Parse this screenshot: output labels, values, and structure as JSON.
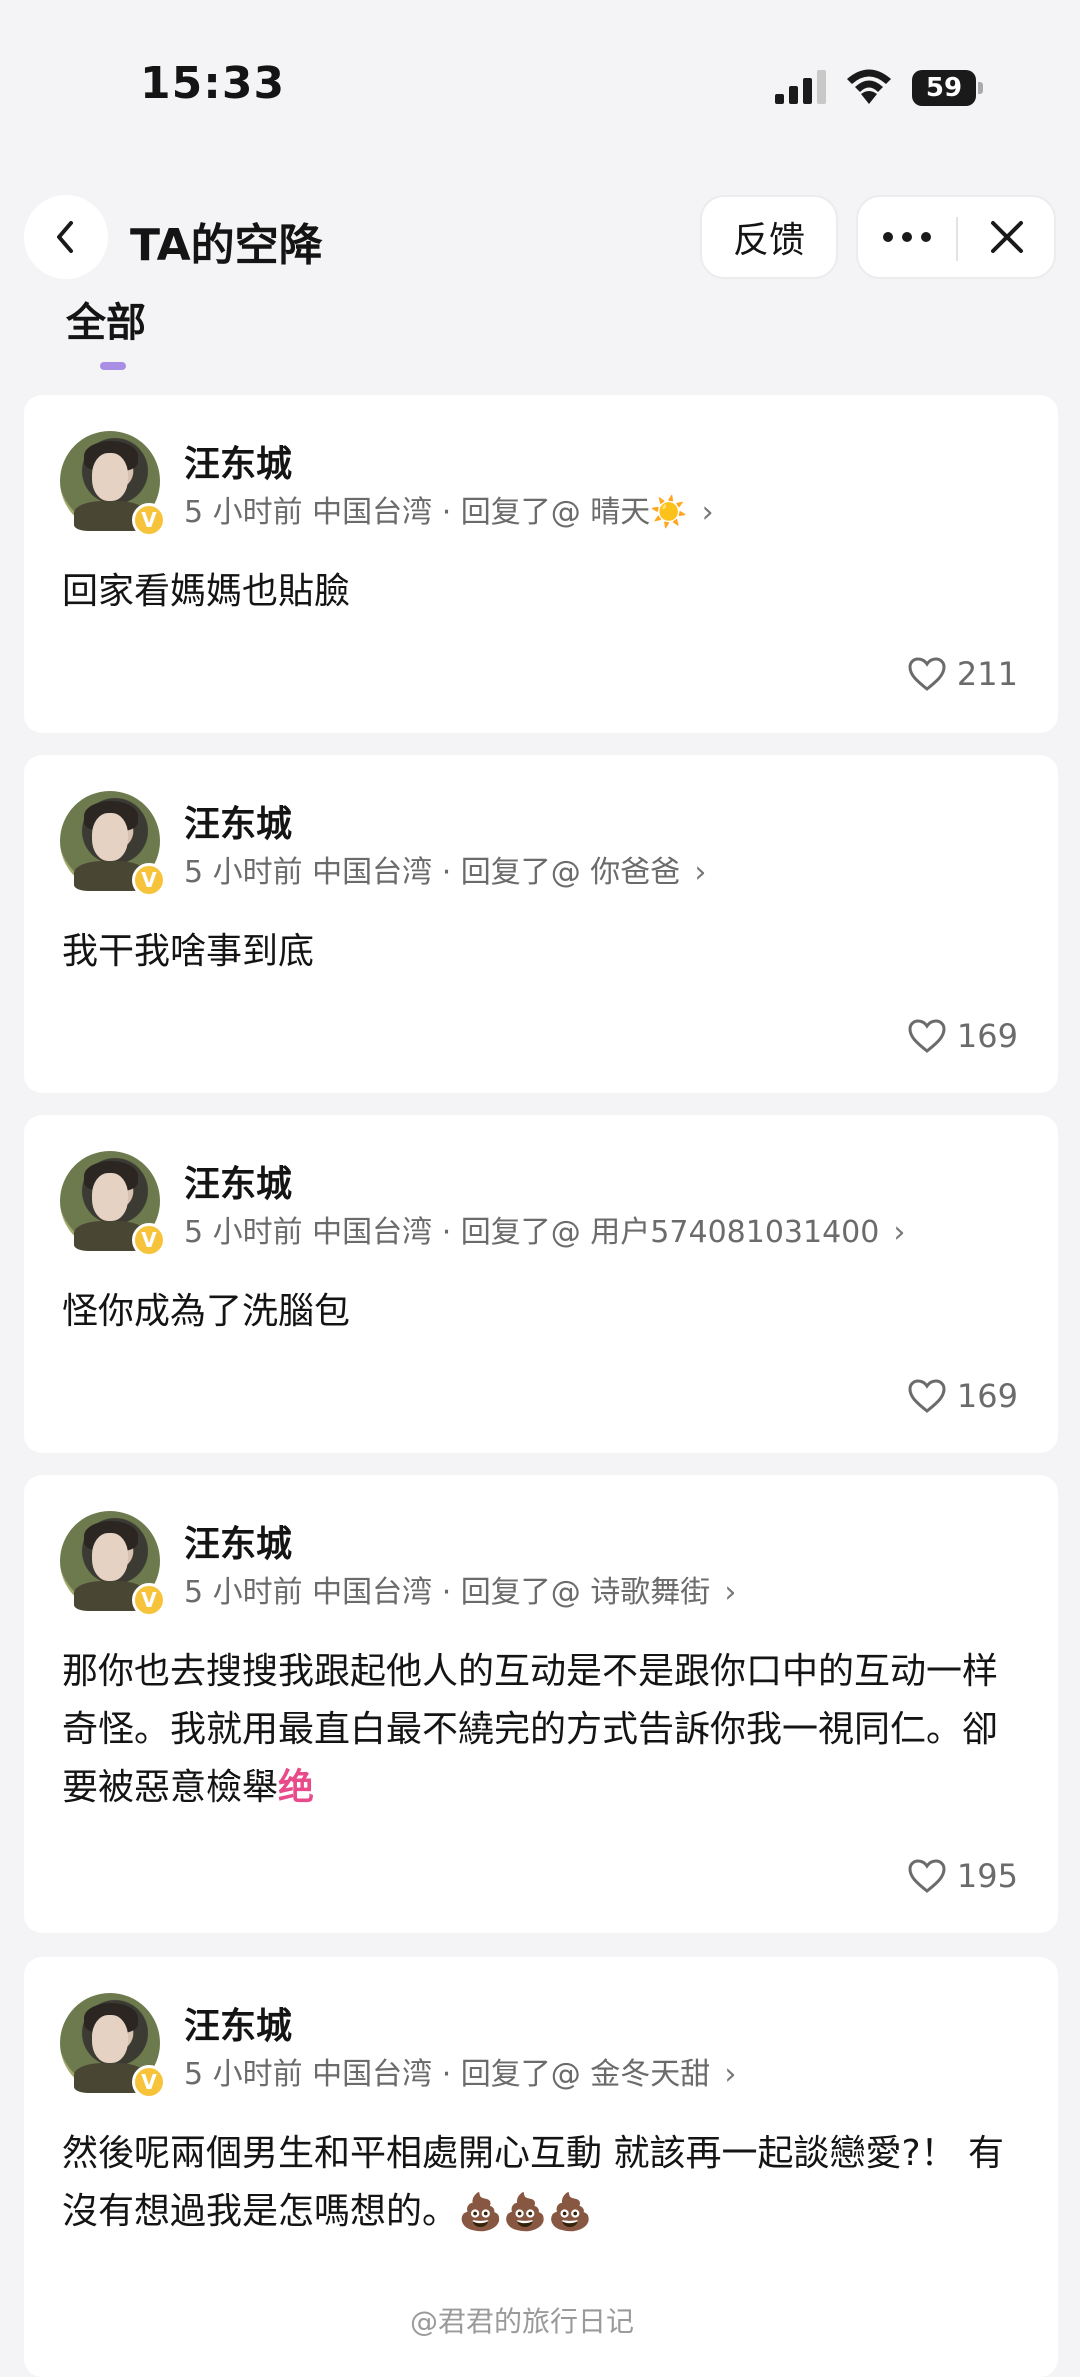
{
  "status_bar": {
    "time": "15:33",
    "battery": "59"
  },
  "nav": {
    "title": "TA的空降",
    "feedback_label": "反馈"
  },
  "tabs": [
    {
      "label": "全部",
      "selected": true
    }
  ],
  "posts": [
    {
      "user": "汪东城",
      "meta": "5 小时前  中国台湾 · 回复了@ 晴天☀️",
      "content": "回家看媽媽也貼臉",
      "likes": "211"
    },
    {
      "user": "汪东城",
      "meta": "5 小时前  中国台湾 · 回复了@ 你爸爸",
      "content": "我干我啥事到底",
      "likes": "169"
    },
    {
      "user": "汪东城",
      "meta": "5 小时前  中国台湾 · 回复了@ 用户574081031400",
      "content": "怪你成為了洗腦包",
      "likes": "169"
    },
    {
      "user": "汪东城",
      "meta": "5 小时前  中国台湾 · 回复了@ 诗歌舞街",
      "content": "那你也去搜搜我跟起他人的互动是不是跟你口中的互动一样奇怪。我就用最直白最不繞完的方式告訴你我一視同仁。卻要被惡意檢舉",
      "content_suffix": "绝",
      "likes": "195"
    },
    {
      "user": "汪东城",
      "meta": "5 小时前  中国台湾 · 回复了@ 金冬天甜",
      "content": "然後呢兩個男生和平相處開心互動 就該再一起談戀愛?！ 有沒有想過我是怎嗎想的。",
      "content_suffix": "💩💩💩",
      "likes": ""
    }
  ],
  "watermark": "@君君的旅行日记",
  "icons": {
    "back": "chevron-left-icon",
    "more": "more-dots-icon",
    "close": "close-icon",
    "like": "heart-outline-icon",
    "verified": "verified-badge-icon"
  },
  "colors": {
    "accent": "#a98ee6",
    "verified": "#f6c33b",
    "suffix_pink": "#e84a8a"
  }
}
